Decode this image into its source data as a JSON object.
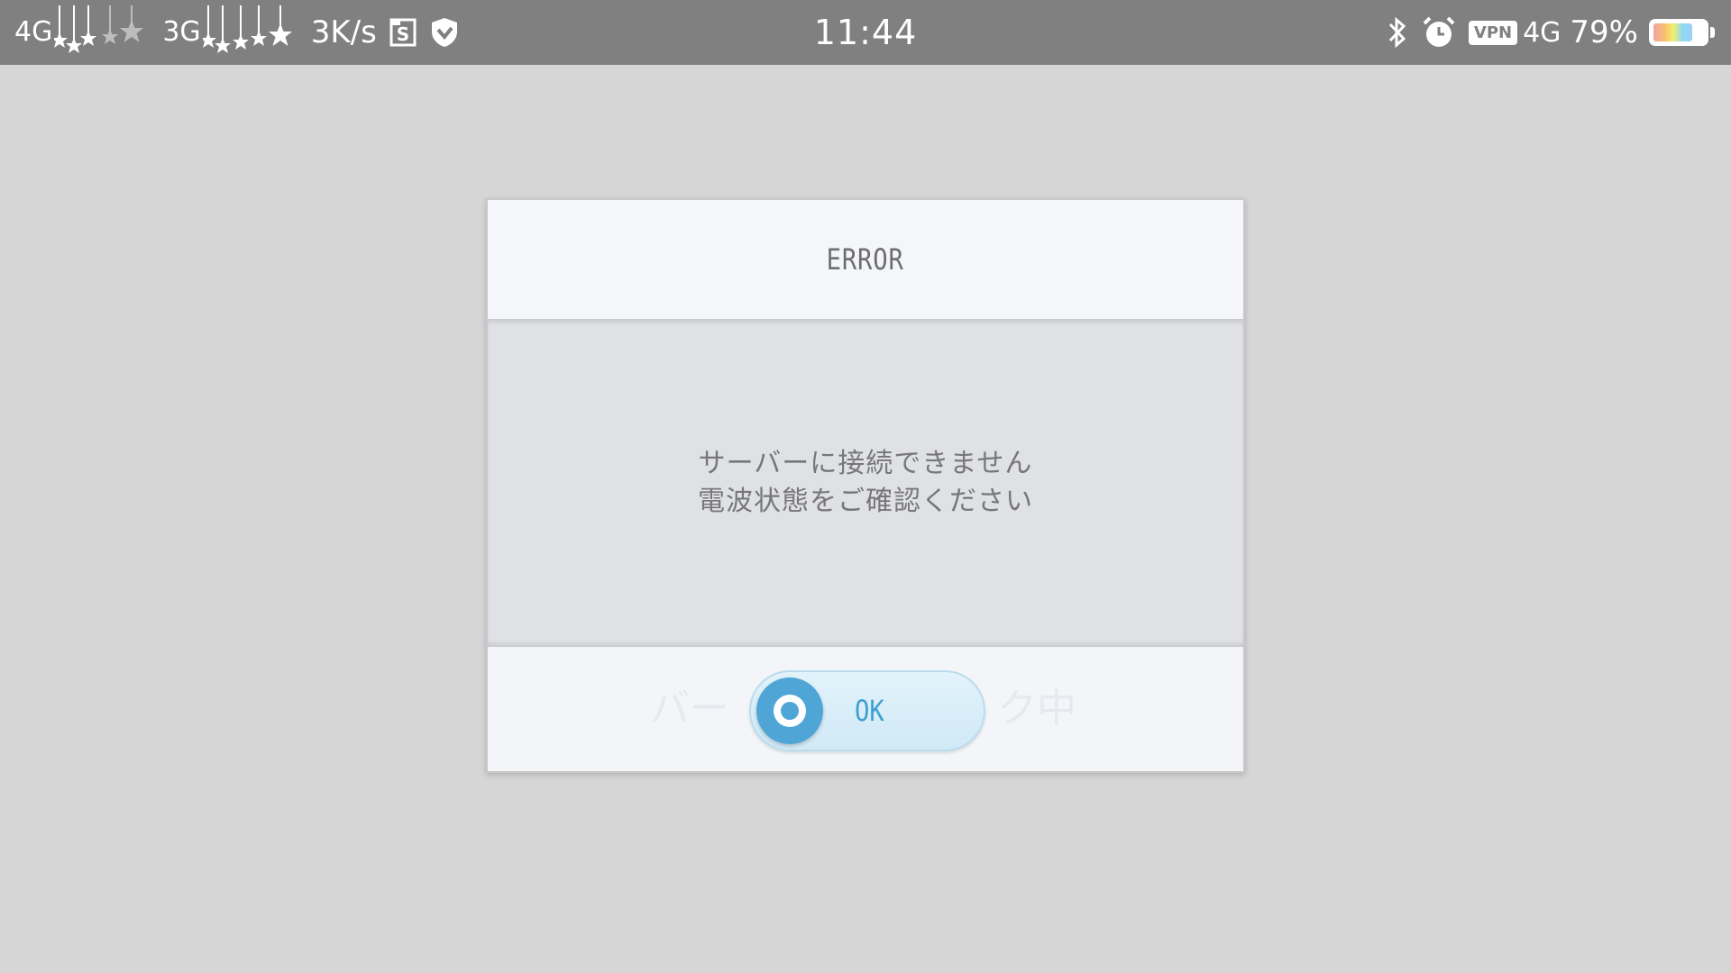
{
  "status_bar": {
    "sim1_network": "4G",
    "sim2_network": "3G",
    "net_speed": "3K/s",
    "time": "11:44",
    "vpn_label": "VPN",
    "data_network": "4G",
    "battery_percent_label": "79%",
    "battery_level": 0.79,
    "icons": [
      "stars-signal-icon",
      "s-app-icon",
      "shield-icon",
      "bluetooth-icon",
      "alarm-icon",
      "battery-icon"
    ]
  },
  "dialog": {
    "title": "ERROR",
    "message_line1": "サーバーに接続できません",
    "message_line2": "電波状態をご確認ください",
    "background_text_left": "バー",
    "background_text_right": "ク中",
    "ok_label": "OK",
    "accent_color": "#4fa6d6"
  }
}
